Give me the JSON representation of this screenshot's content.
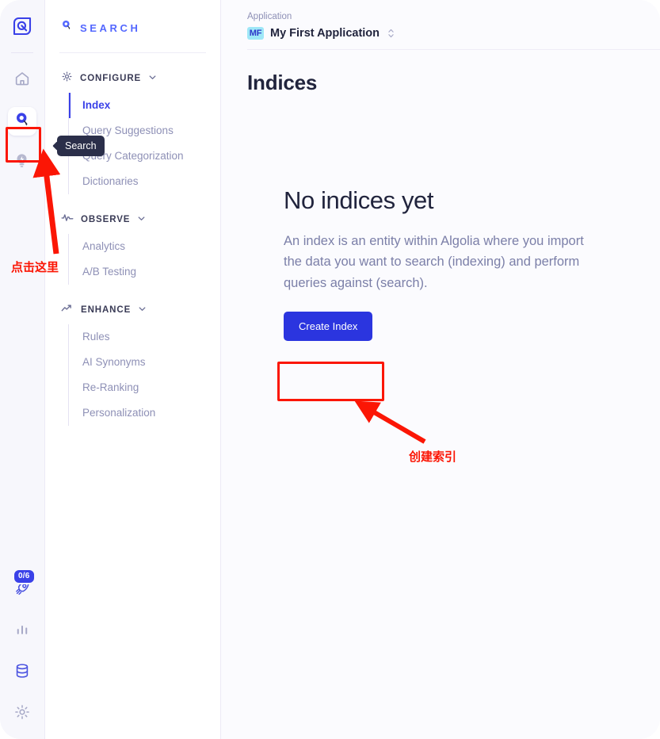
{
  "rail": {
    "logo_icon": "algolia-logo-icon",
    "items": [
      {
        "name": "home",
        "icon": "home-icon",
        "active": false
      },
      {
        "name": "search",
        "icon": "search-balloon-icon",
        "active": true
      },
      {
        "name": "recommend",
        "icon": "lightbulb-spark-icon",
        "active": false
      }
    ],
    "bottom": [
      {
        "name": "onboarding",
        "icon": "rocket-icon",
        "badge": "0/6"
      },
      {
        "name": "analytics",
        "icon": "bar-chart-icon",
        "badge": ""
      },
      {
        "name": "data-sources",
        "icon": "database-icon",
        "badge": ""
      },
      {
        "name": "settings",
        "icon": "gear-icon",
        "badge": ""
      }
    ]
  },
  "sidebar": {
    "brand": {
      "label": "SEARCH",
      "icon": "search-balloon-icon"
    },
    "sections": [
      {
        "title": "CONFIGURE",
        "icon": "gear-icon",
        "chevron": "chevron-down-icon",
        "items": [
          {
            "label": "Index",
            "active": true
          },
          {
            "label": "Query Suggestions",
            "active": false
          },
          {
            "label": "Query Categorization",
            "active": false
          },
          {
            "label": "Dictionaries",
            "active": false
          }
        ]
      },
      {
        "title": "OBSERVE",
        "icon": "pulse-icon",
        "chevron": "chevron-down-icon",
        "items": [
          {
            "label": "Analytics",
            "active": false
          },
          {
            "label": "A/B Testing",
            "active": false
          }
        ]
      },
      {
        "title": "ENHANCE",
        "icon": "trend-up-icon",
        "chevron": "chevron-down-icon",
        "items": [
          {
            "label": "Rules",
            "active": false
          },
          {
            "label": "AI Synonyms",
            "active": false
          },
          {
            "label": "Re-Ranking",
            "active": false
          },
          {
            "label": "Personalization",
            "active": false
          }
        ]
      }
    ]
  },
  "header": {
    "application_label": "Application",
    "application_initials": "MF",
    "application_name": "My First Application",
    "selector_icon": "chevron-up-down-icon"
  },
  "main": {
    "page_title": "Indices",
    "empty_state": {
      "title": "No indices yet",
      "body": "An index is an entity within Algolia where you import the data you want to search (indexing) and perform queries against (search).",
      "button_label": "Create Index"
    }
  },
  "tooltip": {
    "label": "Search"
  },
  "annotations": {
    "left_label": "点击这里",
    "right_label": "创建索引",
    "color": "#fb1605"
  },
  "colors": {
    "accent": "#3a41e8",
    "button": "#2b35df",
    "brand": "#5468ff",
    "muted_text": "#8e90b6",
    "dark_text": "#21243d",
    "rail_bg": "#f7f7fc",
    "main_bg": "#fbfbfe",
    "avatar_bg": "#9ee7f7",
    "annotation": "#fb1605"
  }
}
